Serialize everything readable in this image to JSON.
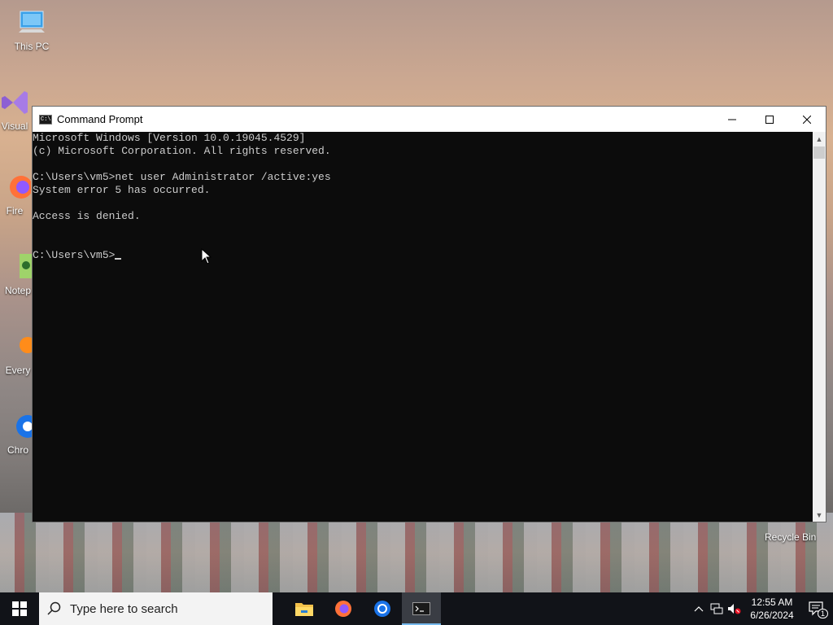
{
  "desktop": {
    "icons": [
      {
        "label": "This PC"
      },
      {
        "label": "Visual"
      },
      {
        "label": "Fire"
      },
      {
        "label": "Notep"
      },
      {
        "label": "Every"
      },
      {
        "label": "Chro"
      }
    ],
    "recycle_bin": "Recycle Bin"
  },
  "window": {
    "title": "Command Prompt",
    "lines": [
      "Microsoft Windows [Version 10.0.19045.4529]",
      "(c) Microsoft Corporation. All rights reserved.",
      "",
      "C:\\Users\\vm5>net user Administrator /active:yes",
      "System error 5 has occurred.",
      "",
      "Access is denied.",
      "",
      ""
    ],
    "prompt": "C:\\Users\\vm5>"
  },
  "taskbar": {
    "search_placeholder": "Type here to search",
    "apps": [
      "file-explorer",
      "firefox",
      "chrome",
      "command-prompt"
    ],
    "time": "12:55 AM",
    "date": "6/26/2024",
    "notification_count": "1"
  },
  "colors": {
    "console_bg": "#0c0c0c",
    "console_fg": "#cccccc",
    "taskbar_bg": "#111318",
    "accent": "#76b9ed"
  }
}
